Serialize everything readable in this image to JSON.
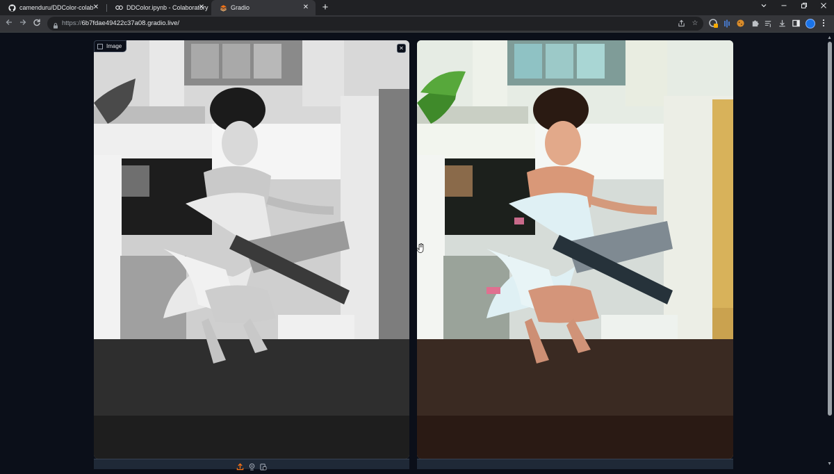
{
  "browser": {
    "tabs": [
      {
        "title": "camenduru/DDColor-colab",
        "icon": "github-icon",
        "active": false
      },
      {
        "title": "DDColor.ipynb - Colaboratory",
        "icon": "colab-icon",
        "active": false
      },
      {
        "title": "Gradio",
        "icon": "gradio-icon",
        "active": true
      }
    ],
    "url": {
      "scheme": "https://",
      "host": "6b7fdae49422c37a08.gradio.live/"
    }
  },
  "input_image": {
    "label": "Image",
    "clear_symbol": "✕",
    "source_icons": [
      "upload-icon",
      "webcam-icon",
      "clipboard-icon"
    ]
  },
  "output_image": {},
  "colors": {
    "page_bg": "#0b0f19",
    "accent": "#f97316",
    "chrome_bg": "#202124",
    "toolbar_bg": "#35363a"
  }
}
